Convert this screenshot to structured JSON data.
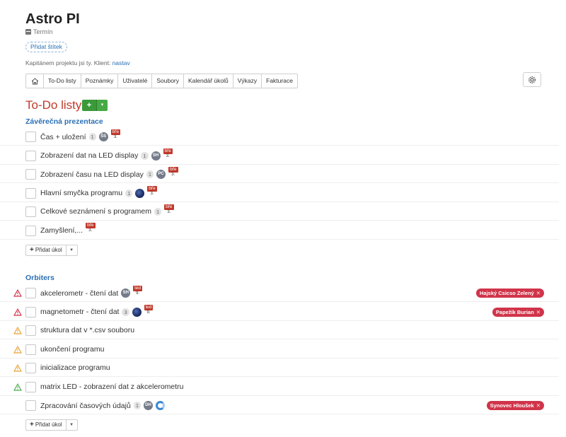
{
  "project": {
    "title": "Astro PI",
    "term_label": "Termín",
    "add_tag_label": "Přidat štítek",
    "captain_text": "Kapitánem projektu jsi ty. Klient: ",
    "client_link": "nastav"
  },
  "tabs": [
    {
      "label": "To-Do listy"
    },
    {
      "label": "Poznámky"
    },
    {
      "label": "Uživatelé"
    },
    {
      "label": "Soubory"
    },
    {
      "label": "Kalendář úkolů"
    },
    {
      "label": "Výkazy"
    },
    {
      "label": "Fakturace"
    }
  ],
  "icons": {
    "home": "home-icon",
    "settings": "gear-icon",
    "warning": "warning-triangle-icon"
  },
  "section": {
    "title": "To-Do listy",
    "add_plus": "+",
    "caret": "▾"
  },
  "add_task_label": "Přidat úkol",
  "colors": {
    "accent": "#c0392b",
    "link": "#2a6fb4",
    "add_green": "#3a9a3a",
    "assignee": "#d0344a",
    "warn_red": "#d0344a",
    "warn_yellow": "#e8a33a",
    "warn_green": "#4caf50"
  },
  "groups": [
    {
      "title": "Závěrečná prezentace",
      "tasks": [
        {
          "name": "Čas + uložení",
          "count": "1",
          "avatar": "ŠS",
          "due_month": "bře",
          "due_day": "3."
        },
        {
          "name": "Zobrazení dat na LED display",
          "count": "1",
          "avatar": "SH",
          "due_month": "bře",
          "due_day": "3."
        },
        {
          "name": "Zobrazení času na LED display",
          "count": "1",
          "avatar": "PC",
          "due_month": "bře",
          "due_day": "3."
        },
        {
          "name": "Hlavní smyčka programu",
          "count": "1",
          "avatar": "",
          "due_month": "bře",
          "due_day": "3."
        },
        {
          "name": "Celkové seznámení s programem",
          "count": "1",
          "due_month": "bře",
          "due_day": "3."
        },
        {
          "name": "Zamyšlení,...",
          "due_month": "bře",
          "due_day": "3."
        }
      ]
    },
    {
      "title": "Orbiters",
      "tasks": [
        {
          "name": "akcelerometr - čtení dat",
          "warn": "red",
          "avatar": "SH",
          "due_month": "led",
          "due_day": "9.",
          "assignee": "Hajský Csicso Zelený"
        },
        {
          "name": "magnetometr - čtení dat",
          "warn": "red",
          "count": "3",
          "avatar": "",
          "due_month": "led",
          "due_day": "9.",
          "assignee": "Papežík Burian"
        },
        {
          "name": "struktura dat v *.csv souboru",
          "warn": "yellow"
        },
        {
          "name": "ukončení programu",
          "warn": "yellow"
        },
        {
          "name": "inicializace programu",
          "warn": "yellow"
        },
        {
          "name": "matrix LED - zobrazení dat z akcelerometru",
          "warn": "green"
        },
        {
          "name": "Zpracování časových údajů",
          "count": "1",
          "avatar": "DH",
          "ring": true,
          "assignee": "Synovec Hloušek"
        }
      ]
    }
  ]
}
